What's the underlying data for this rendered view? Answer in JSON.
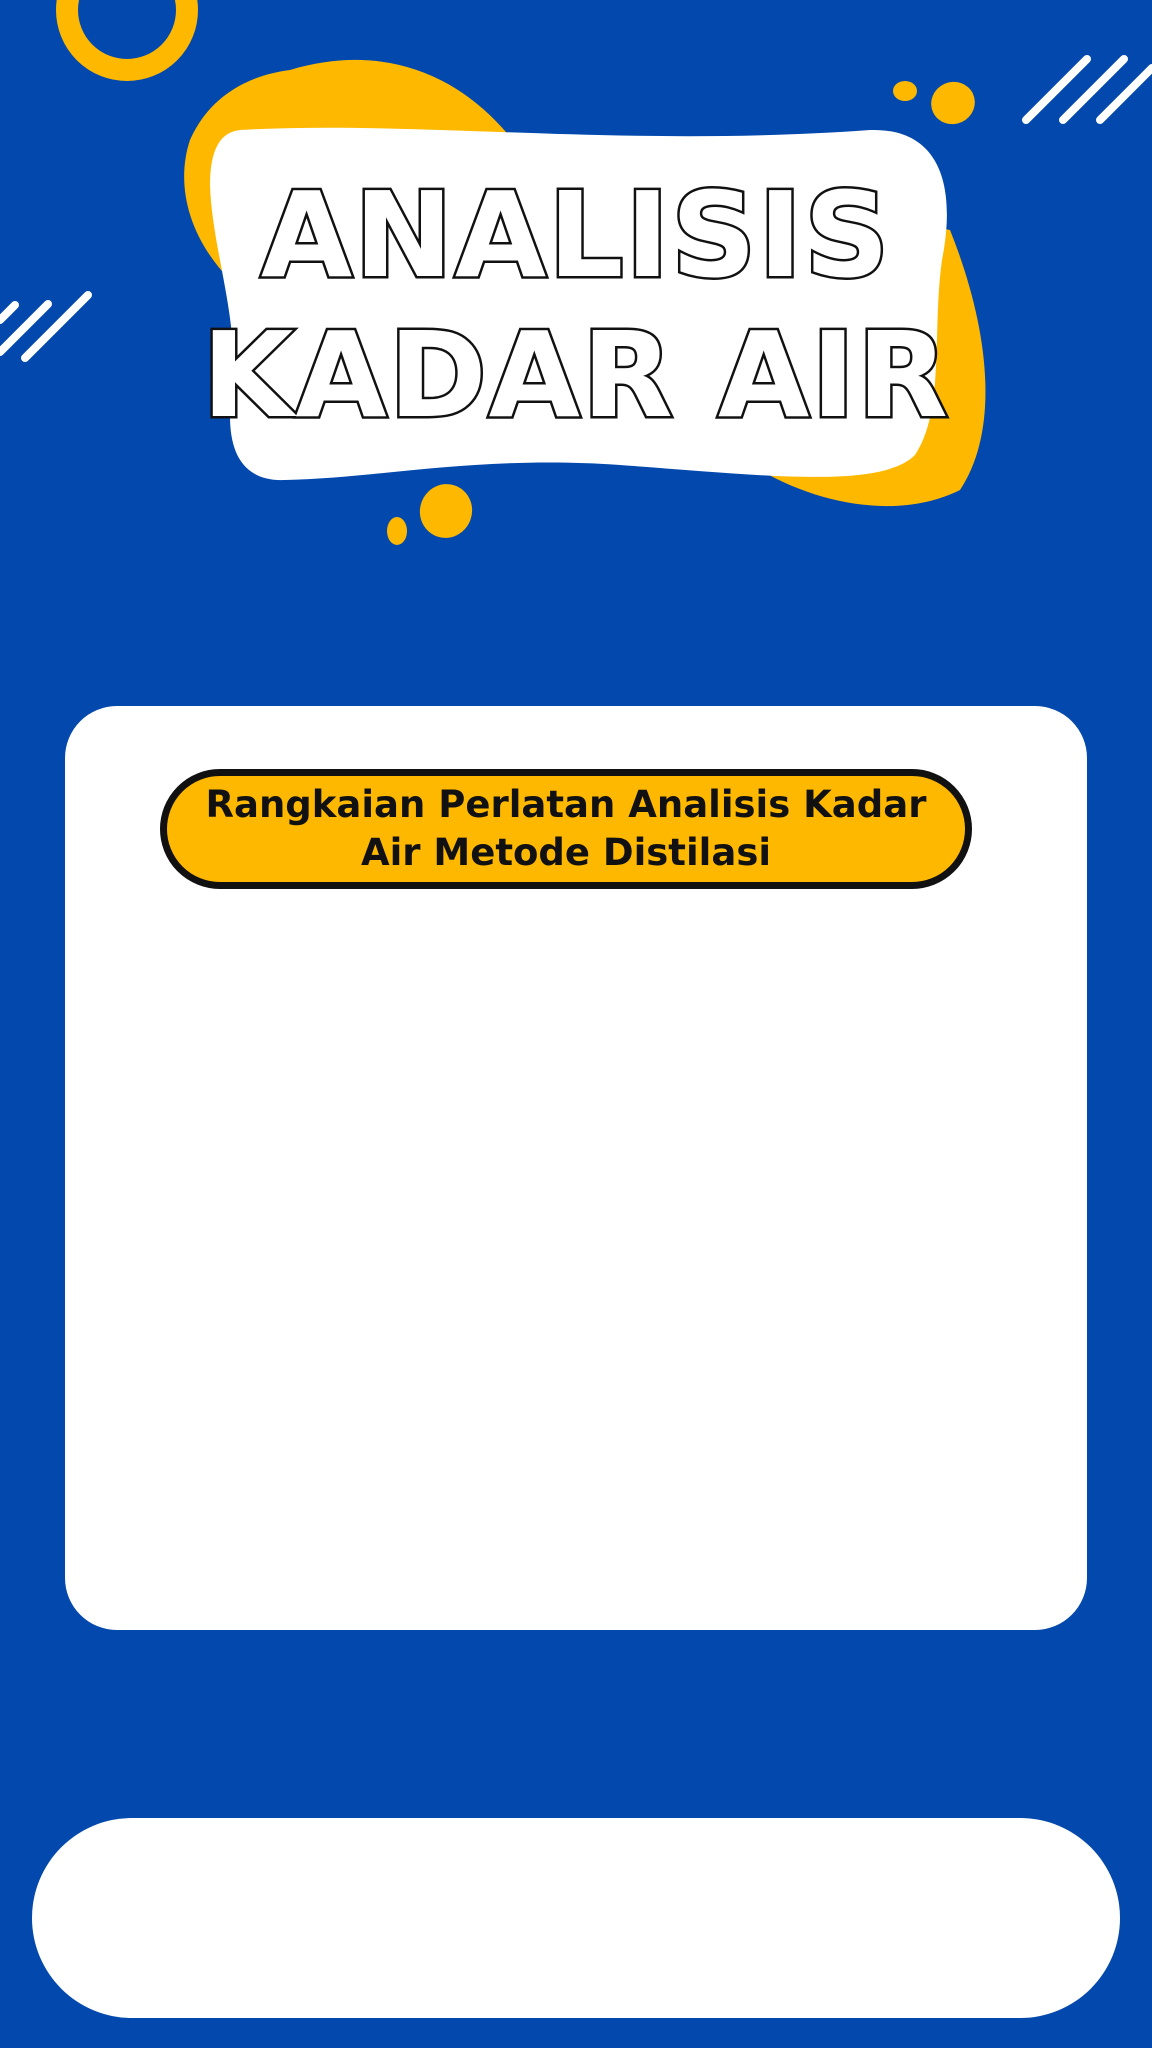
{
  "header": {
    "title_line1": "ANALISIS",
    "title_line2": "KADAR AIR"
  },
  "card": {
    "caption": "Rangkaian Perlatan Analisis Kadar Air Metode Distilasi"
  },
  "colors": {
    "background": "#0349AD",
    "accent_yellow": "#FFB800",
    "panel_white": "#FFFFFF",
    "outline": "#111111"
  },
  "icons": {
    "top_left": "yellow-ring",
    "top_right": "diagonal-stripes",
    "left": "diagonal-stripes",
    "title_backdrop": "yellow-blob",
    "dots": "yellow-dots"
  }
}
